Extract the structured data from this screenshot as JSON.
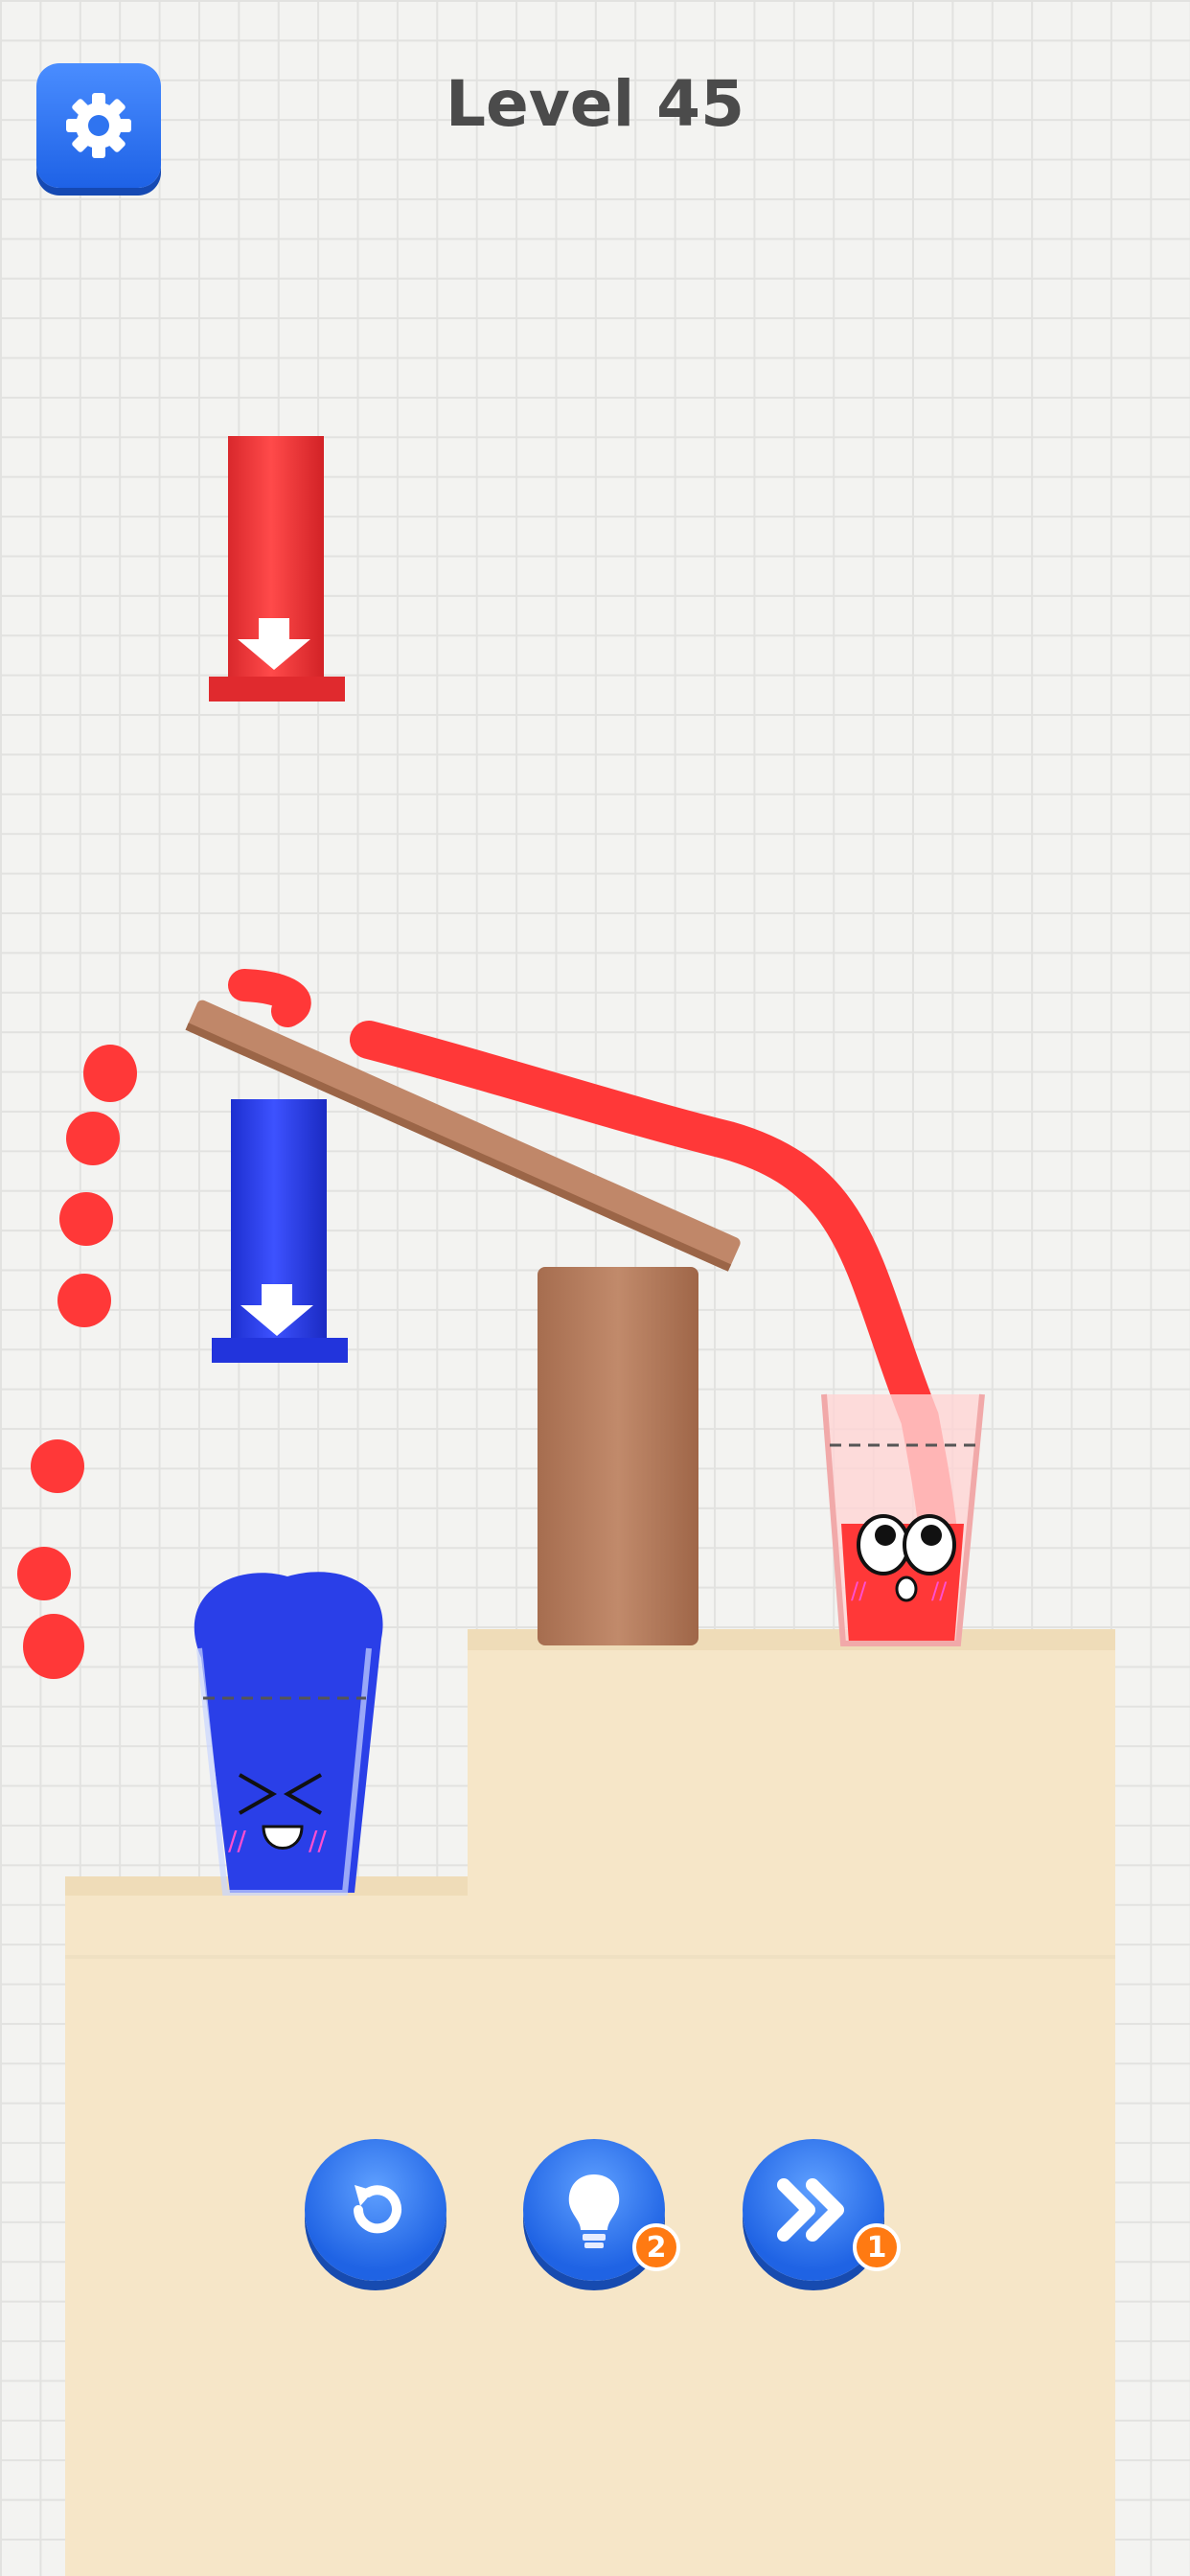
{
  "header": {
    "level_label": "Level 45",
    "settings_icon": "gear-icon"
  },
  "bottom_bar": {
    "restart_icon": "restart-icon",
    "hint_icon": "lightbulb-icon",
    "hint_count": "2",
    "skip_icon": "double-chevron-right-icon",
    "skip_count": "1"
  },
  "colors": {
    "accent_blue": "#1f63e4",
    "red_liquid": "#ff3838",
    "blue_liquid": "#2a3fe8",
    "badge_orange": "#ff7a12",
    "platform": "#f6e6c8",
    "wood": "#b37a5b"
  }
}
